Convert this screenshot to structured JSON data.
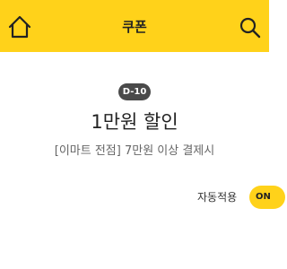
{
  "header": {
    "title": "쿠폰",
    "home_icon": "home-icon",
    "search_icon": "search-icon",
    "background_color": "#ffd21a"
  },
  "coupon": {
    "badge": "D-10",
    "title": "1만원 할인",
    "description": "[이마트 전점] 7만원 이상 결제시"
  },
  "auto_apply": {
    "label": "자동적용",
    "toggle_state": "ON",
    "toggle_color": "#ffd21a"
  }
}
